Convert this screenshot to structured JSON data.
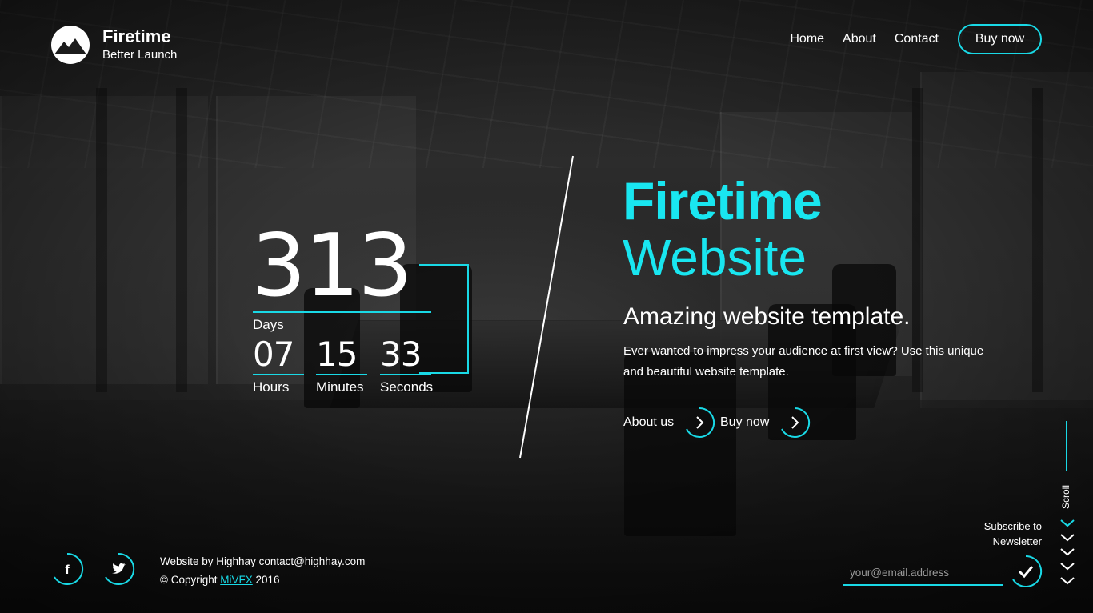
{
  "brand": {
    "title": "Firetime",
    "subtitle": "Better Launch",
    "logo_icon": "mountain-icon"
  },
  "nav": {
    "items": [
      {
        "label": "Home"
      },
      {
        "label": "About"
      },
      {
        "label": "Contact"
      }
    ],
    "cta_label": "Buy now"
  },
  "countdown": {
    "days": {
      "value": "313",
      "label": "Days"
    },
    "hours": {
      "value": "07",
      "label": "Hours"
    },
    "minutes": {
      "value": "15",
      "label": "Minutes"
    },
    "seconds": {
      "value": "33",
      "label": "Seconds"
    }
  },
  "hero": {
    "title_bold": "Firetime",
    "title_light": "Website",
    "tagline": "Amazing website template.",
    "description": "Ever wanted to impress your audience at first view? Use this unique and beautiful website template.",
    "buttons": [
      {
        "label": "About us",
        "icon": "chevron-right-icon"
      },
      {
        "label": "Buy now",
        "icon": "chevron-right-icon"
      }
    ]
  },
  "footer": {
    "social": [
      {
        "name": "facebook-icon"
      },
      {
        "name": "twitter-icon"
      }
    ],
    "credit_line": "Website by Highhay contact@highhay.com",
    "copyright_prefix": "© Copyright ",
    "copyright_link": "MiVFX",
    "copyright_year": " 2016"
  },
  "scroll": {
    "label": "Scroll",
    "chevron_count": 5
  },
  "newsletter": {
    "label_line1": "Subscribe to",
    "label_line2": "Newsletter",
    "placeholder": "your@email.address",
    "value": "",
    "submit_icon": "checkmark-icon"
  },
  "colors": {
    "accent": "#19d9e6",
    "title_accent": "#19e6f0",
    "text": "#ffffff",
    "background": "#1c1c1c"
  }
}
